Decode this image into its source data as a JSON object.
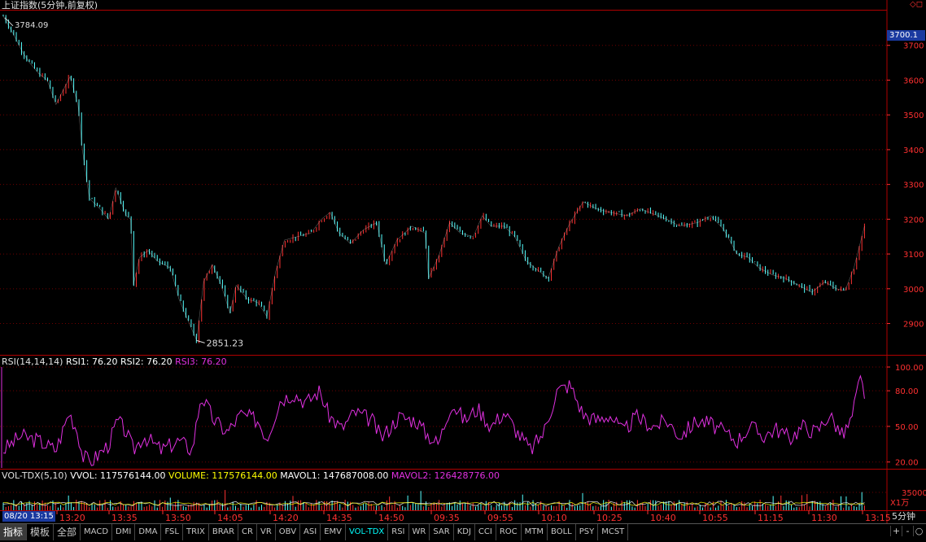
{
  "title": "上证指数(5分钟,前复权)",
  "corner_icons": "◇◻",
  "price_marker": "3700.1",
  "unit_label": "X1万",
  "current_time": "08/20 13:15",
  "period_label": "5分钟",
  "colors": {
    "up": "#ff3232",
    "down": "#54ffff",
    "frame": "#b00000",
    "rsi": "#e030e0",
    "white": "#ffffff",
    "yellow": "#ffff00",
    "axis": "#ff3030"
  },
  "price_panel": {
    "y_ticks": [
      "3700",
      "3600",
      "3500",
      "3400",
      "3300",
      "3200",
      "3100",
      "3000",
      "2900"
    ],
    "high_label": "3784.09",
    "low_label": "2851.23"
  },
  "rsi_panel": {
    "label": "RSI(14,14,14)",
    "rsi1": "RSI1: 76.20",
    "rsi2": "RSI2: 76.20",
    "rsi3": "RSI3: 76.20",
    "y_ticks": [
      "100.00",
      "80.00",
      "50.00",
      "20.00"
    ]
  },
  "vol_panel": {
    "label": "VOL-TDX(5,10)",
    "vvol": "VVOL: 117576144.00",
    "volume": "VOLUME: 117576144.00",
    "mavol1": "MAVOL1: 147687008.00",
    "mavol2": "MAVOL2: 126428776.00",
    "y_ticks": [
      "35000"
    ]
  },
  "x_labels": [
    "13:20",
    "13:35",
    "13:50",
    "14:05",
    "14:20",
    "14:35",
    "14:50",
    "09:35",
    "09:55",
    "10:10",
    "10:25",
    "10:40",
    "10:55",
    "11:15",
    "11:30",
    "13:15"
  ],
  "tabs": [
    "指标",
    "模板",
    "全部",
    "MACD",
    "DMI",
    "DMA",
    "FSL",
    "TRIX",
    "BRAR",
    "CR",
    "VR",
    "OBV",
    "ASI",
    "EMV",
    "VOL-TDX",
    "RSI",
    "WR",
    "SAR",
    "KDJ",
    "CCI",
    "ROC",
    "MTM",
    "BOLL",
    "PSY",
    "MCST"
  ],
  "nav_buttons": [
    "+",
    "-",
    "○"
  ],
  "chart_data": {
    "type": "line",
    "title": "上证指数(5分钟,前复权)",
    "price_range": [
      2851.23,
      3784.09
    ],
    "ylim_price": [
      2810,
      3800
    ],
    "rsi_range": [
      15,
      100
    ],
    "price_path": [
      [
        0.0,
        3784
      ],
      [
        0.01,
        3740
      ],
      [
        0.022,
        3680
      ],
      [
        0.03,
        3650
      ],
      [
        0.04,
        3620
      ],
      [
        0.05,
        3600
      ],
      [
        0.06,
        3530
      ],
      [
        0.068,
        3570
      ],
      [
        0.076,
        3610
      ],
      [
        0.085,
        3530
      ],
      [
        0.09,
        3400
      ],
      [
        0.098,
        3260
      ],
      [
        0.11,
        3230
      ],
      [
        0.12,
        3200
      ],
      [
        0.128,
        3290
      ],
      [
        0.14,
        3210
      ],
      [
        0.145,
        3200
      ],
      [
        0.148,
        3010
      ],
      [
        0.155,
        3090
      ],
      [
        0.165,
        3110
      ],
      [
        0.175,
        3080
      ],
      [
        0.19,
        3060
      ],
      [
        0.2,
        2970
      ],
      [
        0.21,
        2910
      ],
      [
        0.22,
        2852
      ],
      [
        0.228,
        3020
      ],
      [
        0.238,
        3070
      ],
      [
        0.248,
        3010
      ],
      [
        0.258,
        2930
      ],
      [
        0.265,
        3010
      ],
      [
        0.278,
        2970
      ],
      [
        0.29,
        2960
      ],
      [
        0.3,
        2920
      ],
      [
        0.31,
        3050
      ],
      [
        0.32,
        3140
      ],
      [
        0.335,
        3150
      ],
      [
        0.35,
        3160
      ],
      [
        0.362,
        3200
      ],
      [
        0.372,
        3220
      ],
      [
        0.382,
        3160
      ],
      [
        0.395,
        3130
      ],
      [
        0.41,
        3170
      ],
      [
        0.425,
        3190
      ],
      [
        0.435,
        3070
      ],
      [
        0.448,
        3140
      ],
      [
        0.465,
        3180
      ],
      [
        0.48,
        3160
      ],
      [
        0.484,
        3030
      ],
      [
        0.495,
        3090
      ],
      [
        0.508,
        3190
      ],
      [
        0.52,
        3160
      ],
      [
        0.535,
        3150
      ],
      [
        0.545,
        3210
      ],
      [
        0.555,
        3180
      ],
      [
        0.57,
        3180
      ],
      [
        0.582,
        3150
      ],
      [
        0.595,
        3080
      ],
      [
        0.61,
        3050
      ],
      [
        0.62,
        3030
      ],
      [
        0.632,
        3120
      ],
      [
        0.645,
        3190
      ],
      [
        0.66,
        3250
      ],
      [
        0.675,
        3230
      ],
      [
        0.69,
        3220
      ],
      [
        0.71,
        3210
      ],
      [
        0.725,
        3230
      ],
      [
        0.74,
        3215
      ],
      [
        0.755,
        3200
      ],
      [
        0.77,
        3180
      ],
      [
        0.79,
        3190
      ],
      [
        0.805,
        3210
      ],
      [
        0.82,
        3170
      ],
      [
        0.835,
        3100
      ],
      [
        0.848,
        3090
      ],
      [
        0.86,
        3060
      ],
      [
        0.875,
        3040
      ],
      [
        0.89,
        3030
      ],
      [
        0.905,
        3010
      ],
      [
        0.92,
        2990
      ],
      [
        0.935,
        3020
      ],
      [
        0.948,
        3000
      ],
      [
        0.958,
        2995
      ],
      [
        0.968,
        3060
      ],
      [
        0.975,
        3130
      ],
      [
        0.98,
        3180
      ]
    ],
    "rsi_path": [
      [
        0.0,
        30
      ],
      [
        0.02,
        42
      ],
      [
        0.04,
        38
      ],
      [
        0.06,
        30
      ],
      [
        0.075,
        62
      ],
      [
        0.085,
        45
      ],
      [
        0.09,
        25
      ],
      [
        0.1,
        20
      ],
      [
        0.12,
        35
      ],
      [
        0.13,
        55
      ],
      [
        0.14,
        45
      ],
      [
        0.148,
        30
      ],
      [
        0.16,
        42
      ],
      [
        0.18,
        30
      ],
      [
        0.2,
        38
      ],
      [
        0.215,
        30
      ],
      [
        0.225,
        76
      ],
      [
        0.24,
        55
      ],
      [
        0.255,
        45
      ],
      [
        0.27,
        60
      ],
      [
        0.29,
        55
      ],
      [
        0.3,
        40
      ],
      [
        0.315,
        72
      ],
      [
        0.33,
        78
      ],
      [
        0.345,
        70
      ],
      [
        0.36,
        80
      ],
      [
        0.37,
        60
      ],
      [
        0.385,
        48
      ],
      [
        0.4,
        62
      ],
      [
        0.42,
        55
      ],
      [
        0.43,
        40
      ],
      [
        0.45,
        58
      ],
      [
        0.47,
        55
      ],
      [
        0.48,
        45
      ],
      [
        0.495,
        35
      ],
      [
        0.51,
        70
      ],
      [
        0.525,
        55
      ],
      [
        0.54,
        65
      ],
      [
        0.555,
        50
      ],
      [
        0.57,
        62
      ],
      [
        0.585,
        45
      ],
      [
        0.6,
        30
      ],
      [
        0.615,
        45
      ],
      [
        0.63,
        80
      ],
      [
        0.645,
        85
      ],
      [
        0.66,
        60
      ],
      [
        0.675,
        55
      ],
      [
        0.69,
        60
      ],
      [
        0.705,
        45
      ],
      [
        0.72,
        58
      ],
      [
        0.74,
        50
      ],
      [
        0.755,
        55
      ],
      [
        0.77,
        42
      ],
      [
        0.79,
        55
      ],
      [
        0.805,
        52
      ],
      [
        0.82,
        45
      ],
      [
        0.835,
        38
      ],
      [
        0.85,
        50
      ],
      [
        0.865,
        42
      ],
      [
        0.88,
        48
      ],
      [
        0.895,
        40
      ],
      [
        0.91,
        50
      ],
      [
        0.925,
        45
      ],
      [
        0.94,
        60
      ],
      [
        0.955,
        42
      ],
      [
        0.965,
        55
      ],
      [
        0.975,
        90
      ],
      [
        0.98,
        78
      ]
    ]
  }
}
